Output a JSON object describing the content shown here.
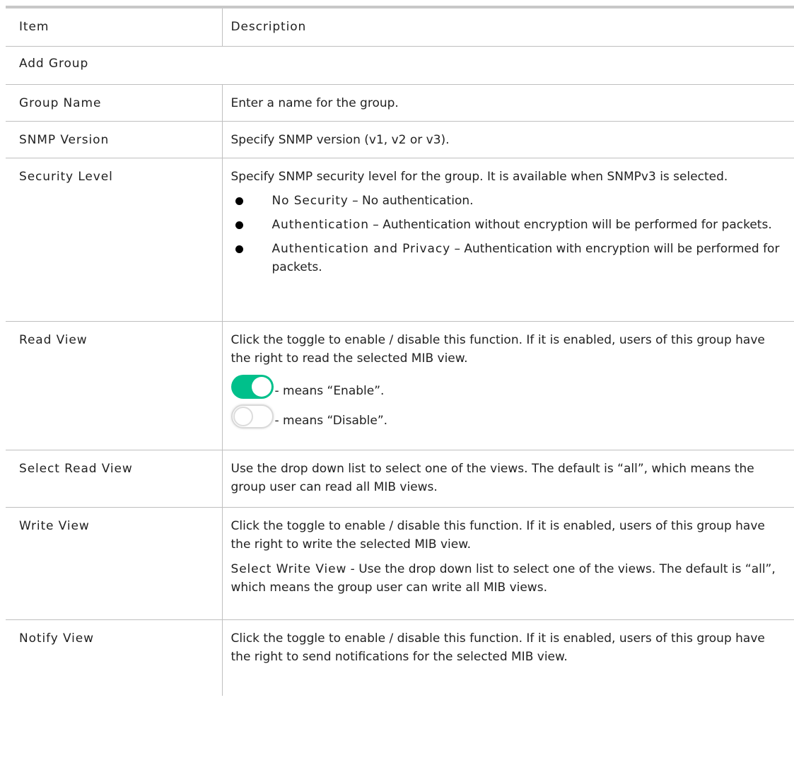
{
  "headers": {
    "item": "Item",
    "description": "Description"
  },
  "section": "Add Group",
  "rows": {
    "group_name": {
      "item": "Group Name",
      "desc": "Enter a name for the group."
    },
    "snmp_version": {
      "item": "SNMP Version",
      "desc": "Specify SNMP version (v1, v2 or v3)."
    },
    "security_level": {
      "item": "Security Level",
      "desc": "Specify SNMP security level for the group. It is available when SNMPv3 is selected.",
      "bullets": [
        {
          "term": "No Security",
          "text": " – No authentication."
        },
        {
          "term": "Authentication",
          "text": " – Authentication without encryption will be performed for packets."
        },
        {
          "term": "Authentication and Privacy",
          "text": " – Authentication with encryption will be performed for packets."
        }
      ]
    },
    "read_view": {
      "item": "Read View",
      "desc": "Click the toggle to enable / disable this function. If it is enabled, users of this group have the right to read the selected MIB view.",
      "enable_text": "- means “Enable”.",
      "disable_text": "- means “Disable”."
    },
    "select_read_view": {
      "item": "Select Read View",
      "desc": "Use the drop down list to select one of the views. The default is “all”, which means the group user can read all MIB views."
    },
    "write_view": {
      "item": "Write View",
      "desc": "Click the toggle to enable / disable this function. If it is enabled, users of this group have the right to write the selected MIB view.",
      "sub_term": "Select Write View",
      "sub_text": " - Use the drop down list to select one of the views. The default is “all”, which means the group user can write all MIB views."
    },
    "notify_view": {
      "item": "Notify View",
      "desc": "Click the toggle to enable / disable this function. If it is enabled, users of this group have the right to send notifications for the selected MIB view."
    }
  },
  "colors": {
    "toggle_on": "#00c08b",
    "toggle_off_border": "#d9d9d9",
    "grid": "#bfbfbf"
  }
}
